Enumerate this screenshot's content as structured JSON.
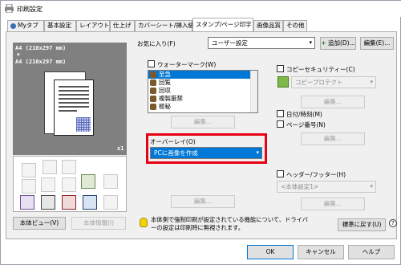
{
  "window": {
    "title": "印刷設定"
  },
  "tabs": [
    {
      "label": "Myタブ"
    },
    {
      "label": "基本設定"
    },
    {
      "label": "レイアウト"
    },
    {
      "label": "仕上げ"
    },
    {
      "label": "カバーシート/挿入紙"
    },
    {
      "label": "スタンプ/ページ印字"
    },
    {
      "label": "画像品質"
    },
    {
      "label": "その他"
    }
  ],
  "preview": {
    "paper_line1": "A4 (210x297 mm)",
    "arrow": "▼",
    "paper_line2": "A4 (210x297 mm)",
    "copies": "x1"
  },
  "left_buttons": {
    "view": "本体ビュー(V)",
    "info": "本体情報(I)"
  },
  "favorites": {
    "label": "お気に入り(F)",
    "value": "ユーザー設定",
    "add": "追加(D)...",
    "edit": "編集(E)..."
  },
  "watermark": {
    "label": "ウォーターマーク(W)",
    "items": [
      "至急",
      "回覧",
      "回収",
      "複製厳禁",
      "極秘"
    ],
    "edit": "編集..."
  },
  "overlay": {
    "label": "オーバーレイ(O)",
    "value": "PCに画像を作成",
    "edit": "編集..."
  },
  "copy_security": {
    "label": "コピーセキュリティー(C)",
    "value": "コピープロテクト",
    "edit": "編集..."
  },
  "date_time": {
    "label": "日付/時刻(M)"
  },
  "page_number": {
    "label": "ページ番号(N)",
    "edit": "編集..."
  },
  "header_footer": {
    "label": "ヘッダー/フッター(H)",
    "value": "<本体設定1>",
    "edit": "編集..."
  },
  "note": "本体側で強制印刷が設定されている機能について、ドライバーの設定は印刷時に無視されます。",
  "restore": "標準に戻す(U)",
  "dialog": {
    "ok": "OK",
    "cancel": "キャンセル",
    "help": "ヘルプ"
  },
  "colors": {
    "accent": "#0078d7",
    "highlight": "#e60012"
  }
}
